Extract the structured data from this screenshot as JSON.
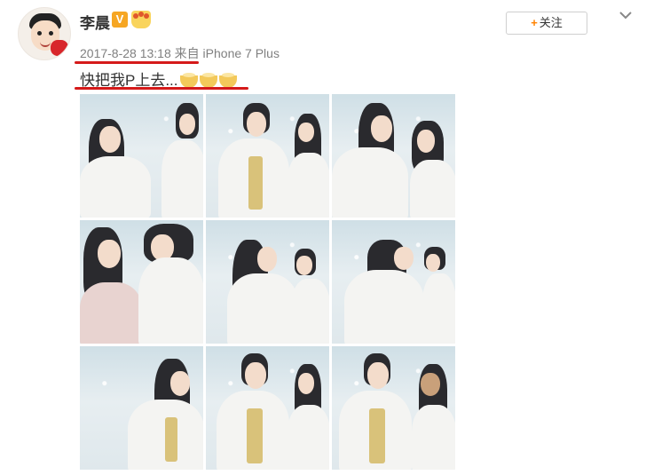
{
  "post": {
    "author": "李晨",
    "badge_v": "V",
    "timestamp": "2017-8-28 13:18",
    "from_label": "来自",
    "device": "iPhone 7 Plus",
    "content_text": "快把我P上去...",
    "follow_label": "关注",
    "follow_plus": "+"
  },
  "icons": {
    "avatar": "avatar-image",
    "verified": "verified-v-icon",
    "vip": "vip-crown-icon",
    "more": "chevron-down-icon",
    "emoji": "clap-emoji-icon"
  },
  "colors": {
    "highlight_underline": "#d51a1a",
    "follow_plus": "#ff8200",
    "badge_v": "#f6a623",
    "meta_text": "#808080",
    "text": "#333333"
  },
  "photos": [
    {
      "id": "1"
    },
    {
      "id": "2"
    },
    {
      "id": "3"
    },
    {
      "id": "4"
    },
    {
      "id": "5"
    },
    {
      "id": "6"
    },
    {
      "id": "7"
    },
    {
      "id": "8"
    },
    {
      "id": "9"
    }
  ]
}
